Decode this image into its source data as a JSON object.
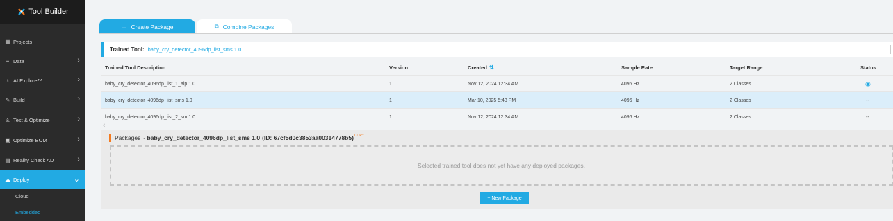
{
  "app": {
    "title": "Tool Builder"
  },
  "sidebar": {
    "items": [
      {
        "label": "Projects",
        "icon": "grid-icon",
        "glyph": "▦",
        "chevron": false
      },
      {
        "label": "Data",
        "icon": "database-icon",
        "glyph": "≡",
        "chevron": true
      },
      {
        "label": "AI Explore™",
        "icon": "bulb-icon",
        "glyph": "♀",
        "chevron": true
      },
      {
        "label": "Build",
        "icon": "wrench-icon",
        "glyph": "✎",
        "chevron": true
      },
      {
        "label": "Test & Optimize",
        "icon": "flask-icon",
        "glyph": "♙",
        "chevron": true
      },
      {
        "label": "Optimize BOM",
        "icon": "chip-icon",
        "glyph": "▣",
        "chevron": true
      },
      {
        "label": "Reality Check AD",
        "icon": "card-icon",
        "glyph": "▤",
        "chevron": true
      },
      {
        "label": "Deploy",
        "icon": "cloud-icon",
        "glyph": "☁",
        "chevron": true,
        "active": true
      }
    ],
    "subitems": [
      {
        "label": "Cloud",
        "active": false
      },
      {
        "label": "Embedded",
        "active": true
      }
    ]
  },
  "tabs": [
    {
      "label": "Create Package",
      "active": true
    },
    {
      "label": "Combine Packages",
      "active": false
    }
  ],
  "trained_tool": {
    "label": "Trained Tool:",
    "value": "baby_cry_detector_4096dp_list_sms 1.0"
  },
  "table": {
    "headers": [
      "Trained Tool Description",
      "Version",
      "Created",
      "Sample Rate",
      "Target Range",
      "Status"
    ],
    "rows": [
      {
        "description": "baby_cry_detector_4096dp_list_1_alp 1.0",
        "version": "1",
        "created": "Nov 12, 2024 12:34 AM",
        "sample_rate": "4096 Hz",
        "target_range": "2 Classes",
        "status": "eye-icon",
        "selected": false
      },
      {
        "description": "baby_cry_detector_4096dp_list_sms 1.0",
        "version": "1",
        "created": "Mar 10, 2025 5:43 PM",
        "sample_rate": "4096 Hz",
        "target_range": "2 Classes",
        "status": "--",
        "selected": true
      },
      {
        "description": "baby_cry_detector_4096dp_list_2_sm 1.0",
        "version": "1",
        "created": "Nov 12, 2024 12:34 AM",
        "sample_rate": "4096 Hz",
        "target_range": "2 Classes",
        "status": "--",
        "selected": false
      }
    ]
  },
  "packages": {
    "title": "Packages",
    "tool_name": "- baby_cry_detector_4096dp_list_sms 1.0",
    "id_text": "(ID: 67cf5d0c3853aa00314778b5)",
    "copy_label": "COPY",
    "empty_message": "Selected trained tool does not yet have any deployed packages.",
    "new_button": "+ New Package"
  },
  "colors": {
    "accent": "#22aae3",
    "orange": "#f47b20",
    "sidebar": "#2b2b2b"
  }
}
